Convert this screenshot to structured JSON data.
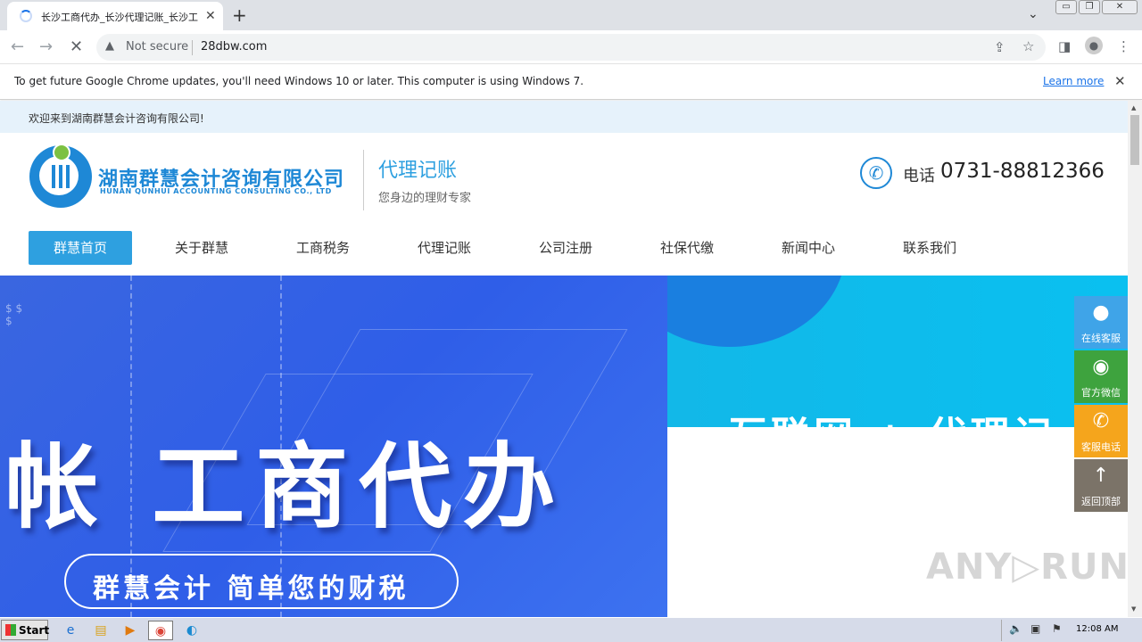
{
  "browser": {
    "tab_title": "长沙工商代办_长沙代理记账_长沙工",
    "new_tab": "+",
    "close_tab": "✕",
    "security_label": "Not secure",
    "url": "28dbw.com",
    "window_controls": [
      "▭",
      "❐",
      "✕"
    ]
  },
  "infobar": {
    "message": "To get future Google Chrome updates, you'll need Windows 10 or later. This computer is using Windows 7.",
    "link": "Learn more",
    "close": "✕"
  },
  "site": {
    "welcome": "欢迎来到湖南群慧会计咨询有限公司!",
    "logo_cn": "湖南群慧会计咨询有限公司",
    "logo_en": "HUNAN QUNHUI ACCOUNTING CONSULTING CO., LTD",
    "slogan_title": "代理记账",
    "slogan_sub": "您身边的理财专家",
    "phone_label": "电话",
    "phone_number": "0731-88812366",
    "nav": [
      "群慧首页",
      "关于群慧",
      "工商税务",
      "代理记账",
      "公司注册",
      "社保代缴",
      "新闻中心",
      "联系我们"
    ],
    "banner_main": "帐 工商代办",
    "banner_pill": "群慧会计 简单您的财税",
    "banner2_text": "互联网 + 代理记",
    "watermark": "ANY▷RUN"
  },
  "side_panel": [
    {
      "label": "在线客服",
      "icon": "qq-icon",
      "color": "#3fa4e8"
    },
    {
      "label": "官方微信",
      "icon": "wechat-icon",
      "color": "#3ea33e"
    },
    {
      "label": "客服电话",
      "icon": "phone-icon",
      "color": "#f5a51c"
    },
    {
      "label": "返回顶部",
      "icon": "arrow-up-icon",
      "color": "#7b7368"
    }
  ],
  "taskbar": {
    "start": "Start",
    "clock": "12:08 AM"
  }
}
